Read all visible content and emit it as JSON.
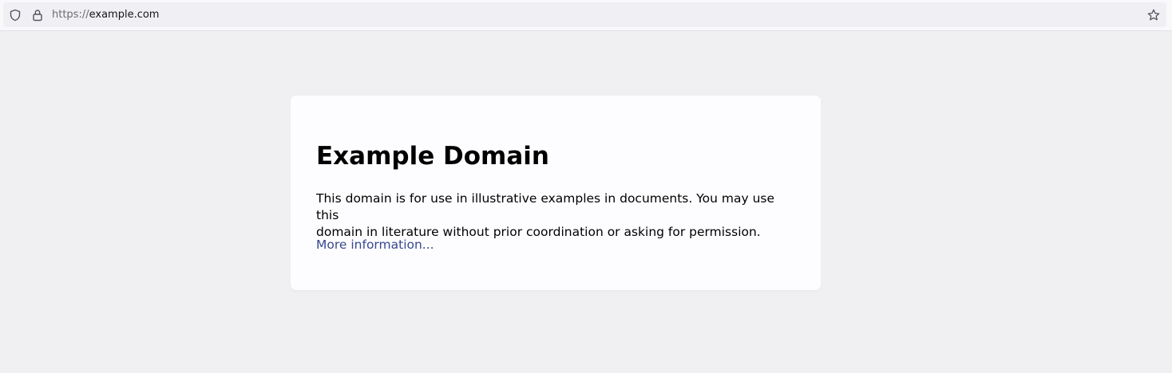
{
  "browser": {
    "url_scheme": "https://",
    "url_host": "example.com",
    "icons": {
      "site_info": "shield-icon",
      "security": "lock-icon",
      "bookmark": "star-icon"
    }
  },
  "page": {
    "heading": "Example Domain",
    "paragraph_line1": "This domain is for use in illustrative examples in documents. You may use this",
    "paragraph_line2": "domain in literature without prior coordination or asking for permission.",
    "link_label": "More information..."
  },
  "colors": {
    "page_background": "#f0f0f2",
    "card_background": "#fdfdff",
    "link": "#38488f"
  }
}
